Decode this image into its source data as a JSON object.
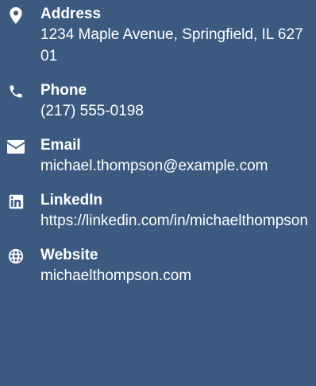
{
  "contacts": [
    {
      "icon": "location-pin-icon",
      "label": "Address",
      "value": "1234 Maple Avenue, Springfield, IL 62701"
    },
    {
      "icon": "phone-icon",
      "label": "Phone",
      "value": "(217) 555-0198"
    },
    {
      "icon": "envelope-icon",
      "label": "Email",
      "value": "michael.thompson@example.com"
    },
    {
      "icon": "linkedin-icon",
      "label": "LinkedIn",
      "value": "https://linkedin.com/in/michaelthompson"
    },
    {
      "icon": "globe-icon",
      "label": "Website",
      "value": "michaelthompson.com"
    }
  ],
  "colors": {
    "background": "#3c5a80",
    "text": "#ffffff"
  }
}
